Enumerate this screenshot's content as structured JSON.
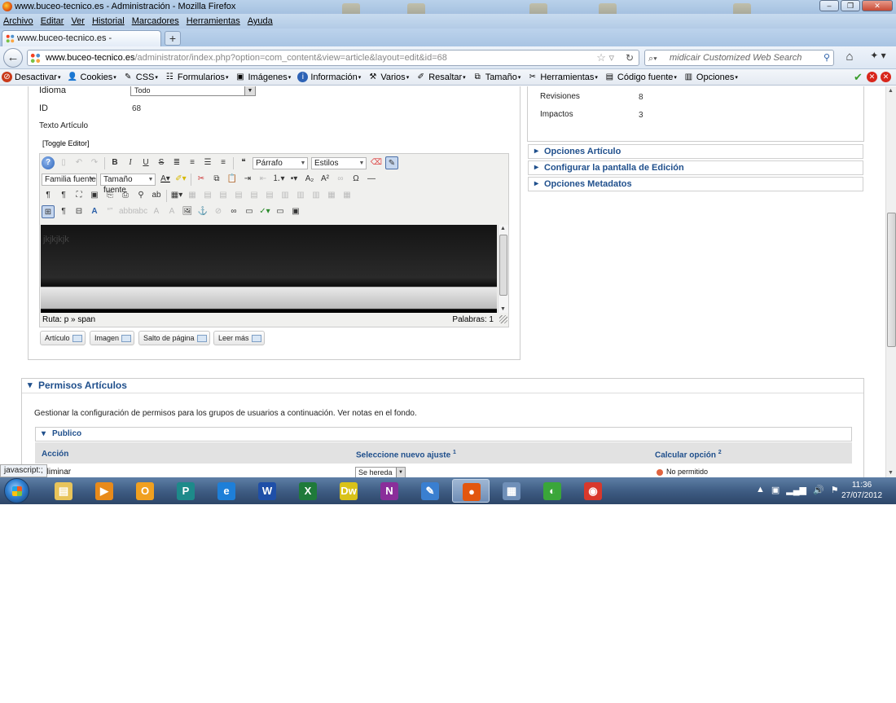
{
  "window": {
    "title": "www.buceo-tecnico.es - Administración - Mozilla Firefox",
    "buttons": [
      "–",
      "❐",
      "✕"
    ]
  },
  "menubar": [
    "Archivo",
    "Editar",
    "Ver",
    "Historial",
    "Marcadores",
    "Herramientas",
    "Ayuda"
  ],
  "tab": {
    "label": "www.buceo-tecnico.es - Administración",
    "new_tab": "+"
  },
  "navbar": {
    "url_host": "www.buceo-tecnico.es",
    "url_path": "/administrator/index.php?option=com_content&view=article&layout=edit&id=68",
    "search_placeholder": "midicair Customized Web Search"
  },
  "devbar": {
    "items": [
      {
        "label": "Desactivar",
        "icon": "no-icon"
      },
      {
        "label": "Cookies",
        "icon": "user-icon"
      },
      {
        "label": "CSS",
        "icon": "pencil-icon"
      },
      {
        "label": "Formularios",
        "icon": "form-icon"
      },
      {
        "label": "Imágenes",
        "icon": "image-icon"
      },
      {
        "label": "Información",
        "icon": "info-icon"
      },
      {
        "label": "Varios",
        "icon": "wrench-icon"
      },
      {
        "label": "Resaltar",
        "icon": "highlighter-icon"
      },
      {
        "label": "Tamaño",
        "icon": "resize-icon"
      },
      {
        "label": "Herramientas",
        "icon": "tools-icon"
      },
      {
        "label": "Código fuente",
        "icon": "source-icon"
      },
      {
        "label": "Opciones",
        "icon": "options-icon"
      }
    ],
    "status_colors": {
      "ok": "#3a9d2a",
      "error": "#d8261b"
    }
  },
  "article": {
    "idioma_label": "Idioma",
    "idioma_value": "Todo",
    "id_label": "ID",
    "id_value": "68",
    "texto_label": "Texto Artículo",
    "toggle_editor": "[Toggle Editor]"
  },
  "editor": {
    "paragraph_select": "Párrafo",
    "styles_select": "Estilos",
    "font_family_select": "Familia fuente",
    "font_size_select": "Tamaño fuente",
    "content": "jkjkjkjk",
    "path_label": "Ruta:",
    "path_value": "p » span",
    "words": "Palabras: 1",
    "extra_buttons": [
      "Artículo",
      "Imagen",
      "Salto de página",
      "Leer más"
    ]
  },
  "stats": {
    "revisiones_label": "Revisiones",
    "revisiones_value": "8",
    "impactos_label": "Impactos",
    "impactos_value": "3"
  },
  "accordions": [
    "Opciones Artículo",
    "Configurar la pantalla de Edición",
    "Opciones Metadatos"
  ],
  "permissions": {
    "title": "Permisos Artículos",
    "description": "Gestionar la configuración de permisos para los grupos de usuarios a continuación. Ver notas en el fondo.",
    "group": "Publico",
    "col_action": "Acción",
    "col_new": "Seleccione nuevo ajuste",
    "col_new_sup": "1",
    "col_calc": "Calcular opción",
    "col_calc_sup": "2",
    "row_action": "Eliminar",
    "row_select": "Se hereda",
    "row_calc": "No permitido"
  },
  "statusbar_text": "javascript:;",
  "taskbar": {
    "apps": [
      {
        "name": "explorer",
        "color": "#e8c45a",
        "glyph": "▤"
      },
      {
        "name": "media-player",
        "color": "#e88a1a",
        "glyph": "▶"
      },
      {
        "name": "outlook",
        "color": "#f0a020",
        "glyph": "O"
      },
      {
        "name": "publisher",
        "color": "#1d8a8a",
        "glyph": "P"
      },
      {
        "name": "internet-explorer",
        "color": "#1e7fd8",
        "glyph": "e"
      },
      {
        "name": "word",
        "color": "#1f4fa8",
        "glyph": "W"
      },
      {
        "name": "excel",
        "color": "#1f7a3a",
        "glyph": "X"
      },
      {
        "name": "dreamweaver",
        "color": "#d9c21a",
        "glyph": "Dw"
      },
      {
        "name": "onenote",
        "color": "#8a2e9a",
        "glyph": "N"
      },
      {
        "name": "feather-app",
        "color": "#3a7fd0",
        "glyph": "✎"
      },
      {
        "name": "firefox",
        "color": "#e2560e",
        "glyph": "●"
      },
      {
        "name": "calculator",
        "color": "#6f8fb8",
        "glyph": "▦"
      },
      {
        "name": "app-green",
        "color": "#3aa63a",
        "glyph": "◐"
      },
      {
        "name": "chrome",
        "color": "#d8382c",
        "glyph": "◉"
      }
    ],
    "tray": [
      "▲",
      "▣",
      "▂▄▆",
      "🔊",
      "⚑"
    ],
    "time": "11:36",
    "date": "27/07/2012"
  }
}
